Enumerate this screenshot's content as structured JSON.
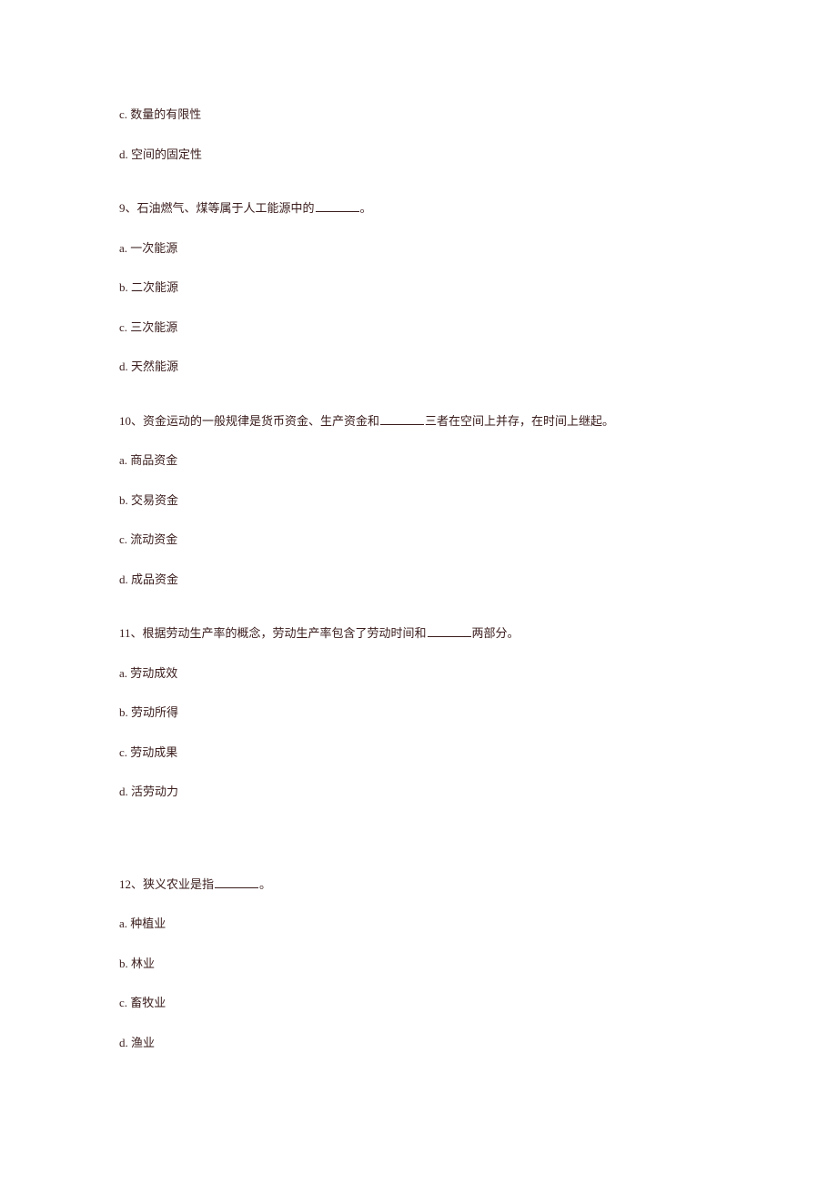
{
  "orphan_options": [
    "c. 数量的有限性",
    "d. 空间的固定性"
  ],
  "questions": [
    {
      "prefix": "9、石油燃气、煤等属于人工能源中的",
      "suffix": "。",
      "options": [
        "a. 一次能源",
        "b. 二次能源",
        "c. 三次能源",
        "d. 天然能源"
      ]
    },
    {
      "prefix": "10、资金运动的一般规律是货币资金、生产资金和",
      "suffix": "三者在空间上并存，在时间上继起。",
      "options": [
        "a. 商品资金",
        "b. 交易资金",
        "c. 流动资金",
        "d. 成品资金"
      ]
    },
    {
      "prefix": "11、根据劳动生产率的概念，劳动生产率包含了劳动时间和",
      "suffix": "两部分。",
      "options": [
        "a. 劳动成效",
        "b. 劳动所得",
        "c. 劳动成果",
        "d. 活劳动力"
      ]
    },
    {
      "prefix": "12、狭义农业是指",
      "suffix": "。",
      "options": [
        "a. 种植业",
        "b. 林业",
        "c. 畜牧业",
        "d. 渔业"
      ]
    }
  ]
}
